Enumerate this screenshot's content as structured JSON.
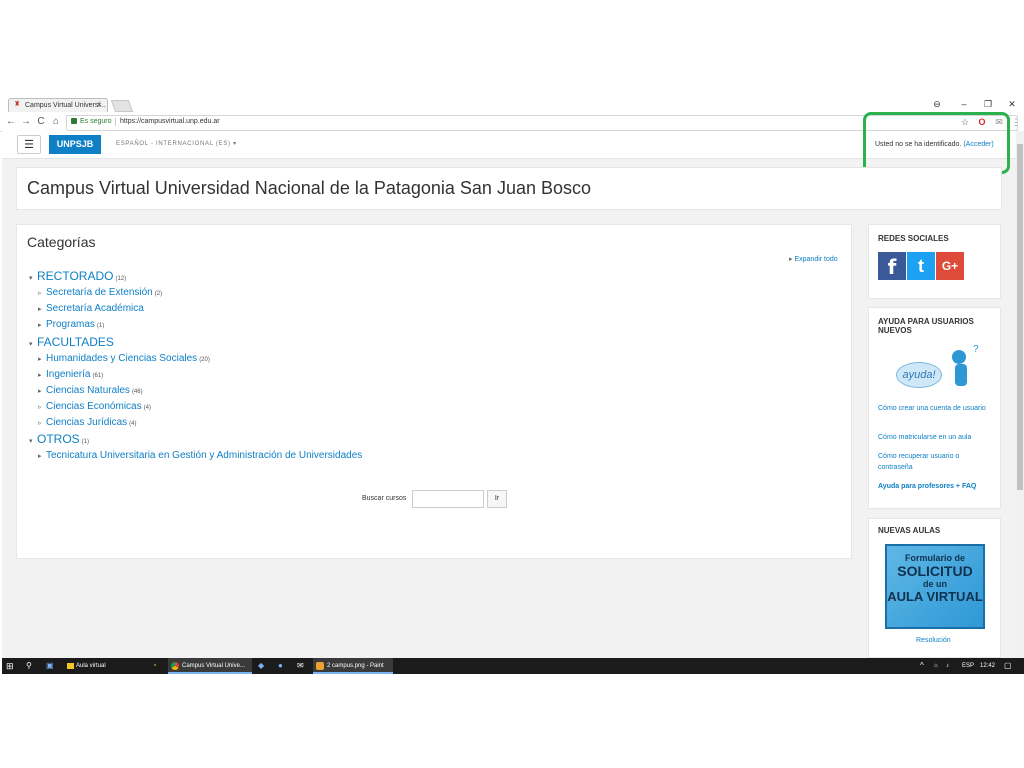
{
  "browser": {
    "tab_title": "Campus Virtual Universi...",
    "tab_close": "×",
    "secure_label": "Es seguro",
    "url": "https://campusvirtual.unp.edu.ar",
    "window_buttons": [
      "⊖",
      "–",
      "❐",
      "✕"
    ],
    "nav_buttons": [
      "←",
      "→",
      "C",
      "⌂"
    ],
    "extensions": [
      "☆",
      "O",
      "✉",
      "⋮"
    ]
  },
  "navbar": {
    "menu_icon": "☰",
    "brand": "UNPSJB",
    "language": "ESPAÑOL - INTERNACIONAL (ES) ▾",
    "login_text": "Usted no se ha identificado.",
    "login_link": "(Acceder)"
  },
  "hero": {
    "title": "Campus Virtual Universidad Nacional de la Patagonia San Juan Bosco"
  },
  "categories": {
    "title": "Categorías",
    "expand_label": "Expandir todo",
    "items": [
      {
        "label": "RECTORADO",
        "count": "(12)",
        "level": 1,
        "arrow": "▾"
      },
      {
        "label": "Secretaría de Extensión",
        "count": "(2)",
        "level": 2,
        "arrow": "▹"
      },
      {
        "label": "Secretaría Académica",
        "count": "",
        "level": 2,
        "arrow": "▸"
      },
      {
        "label": "Programas",
        "count": "(1)",
        "level": 2,
        "arrow": "▸"
      },
      {
        "label": "FACULTADES",
        "count": "",
        "level": 1,
        "arrow": "▾"
      },
      {
        "label": "Humanidades y Ciencias Sociales",
        "count": "(20)",
        "level": 2,
        "arrow": "▸"
      },
      {
        "label": "Ingeniería",
        "count": "(61)",
        "level": 2,
        "arrow": "▸"
      },
      {
        "label": "Ciencias Naturales",
        "count": "(46)",
        "level": 2,
        "arrow": "▸"
      },
      {
        "label": "Ciencias Económicas",
        "count": "(4)",
        "level": 2,
        "arrow": "▹"
      },
      {
        "label": "Ciencias Jurídicas",
        "count": "(4)",
        "level": 2,
        "arrow": "▹"
      },
      {
        "label": "OTROS",
        "count": "(1)",
        "level": 1,
        "arrow": "▾"
      },
      {
        "label": "Tecnicatura Universitaria en Gestión y Administración de Universidades",
        "count": "",
        "level": 2,
        "arrow": "▸"
      }
    ]
  },
  "search": {
    "label": "Buscar cursos",
    "button": "Ir",
    "value": ""
  },
  "sidebar": {
    "social_title": "REDES SOCIALES",
    "social_icons": [
      "f",
      "t",
      "G+"
    ],
    "help_title": "AYUDA PARA USUARIOS NUEVOS",
    "help_image_text": "ayuda!",
    "help_links": [
      "Cómo crear una cuenta de usuario",
      "Cómo matricularse en un aula",
      "Cómo recuperar usuario o contraseña",
      "Ayuda para profesores + FAQ"
    ],
    "new_title": "NUEVAS AULAS",
    "form_lines": [
      "Formulario de",
      "SOLICITUD",
      "de un",
      "AULA VIRTUAL"
    ],
    "resolution_link": "Resolución"
  },
  "taskbar": {
    "items": [
      "Aula virtual",
      "Campus Virtual Unive...",
      "2 campus.png - Paint"
    ],
    "lang": "ESP",
    "time": "12:42"
  },
  "colors": {
    "accent": "#0f80c5",
    "highlight": "#2bb24c"
  }
}
